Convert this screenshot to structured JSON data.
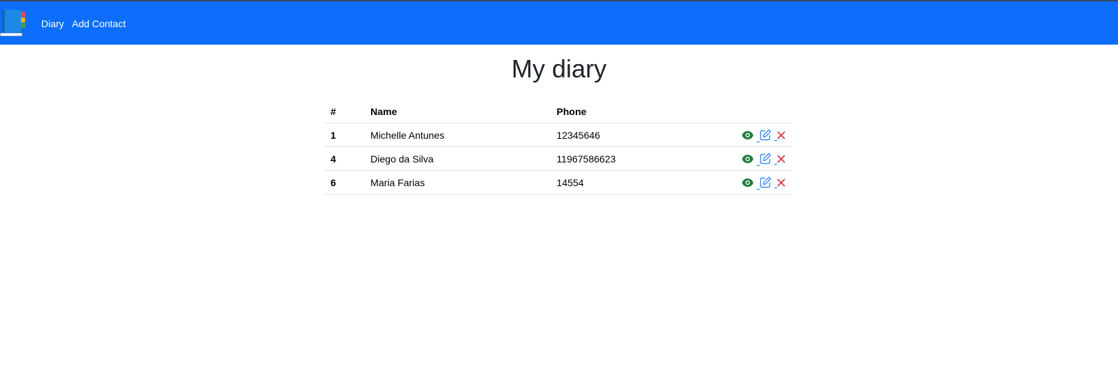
{
  "navbar": {
    "brand_icon": "diary-book-icon",
    "links": [
      {
        "label": "Diary"
      },
      {
        "label": "Add Contact"
      }
    ],
    "background": "#0d6efd"
  },
  "page": {
    "title": "My diary"
  },
  "table": {
    "columns": [
      "#",
      "Name",
      "Phone",
      ""
    ],
    "rows": [
      {
        "id": "1",
        "name": "Michelle Antunes",
        "phone": "12345646"
      },
      {
        "id": "4",
        "name": "Diego da Silva",
        "phone": "11967586623"
      },
      {
        "id": "6",
        "name": "Maria Farias",
        "phone": "14554"
      }
    ],
    "actions": [
      {
        "icon": "eye-icon",
        "color": "#1e7a3c"
      },
      {
        "icon": "edit-icon",
        "color": "#3d8bfd"
      },
      {
        "icon": "close-icon",
        "color": "#dc3545"
      }
    ]
  }
}
